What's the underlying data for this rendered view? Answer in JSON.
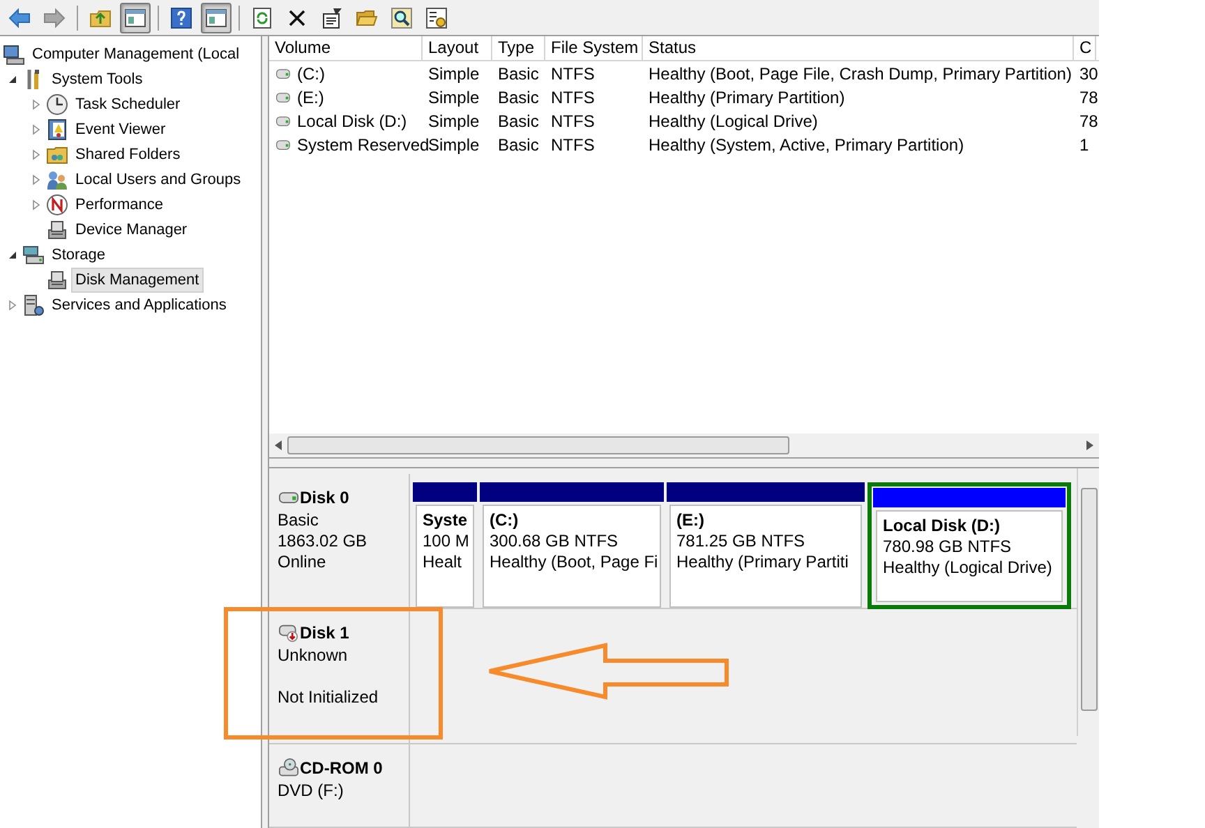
{
  "toolbar": [
    {
      "kind": "back",
      "pressed": false
    },
    {
      "kind": "forward",
      "pressed": false
    },
    {
      "kind": "separator"
    },
    {
      "kind": "folder-up",
      "pressed": false
    },
    {
      "kind": "panel",
      "pressed": true
    },
    {
      "kind": "separator"
    },
    {
      "kind": "help",
      "pressed": false
    },
    {
      "kind": "panel",
      "pressed": true
    },
    {
      "kind": "separator"
    },
    {
      "kind": "refresh",
      "pressed": false
    },
    {
      "kind": "delete",
      "pressed": false
    },
    {
      "kind": "properties",
      "pressed": false
    },
    {
      "kind": "open",
      "pressed": false
    },
    {
      "kind": "search",
      "pressed": false
    },
    {
      "kind": "settings",
      "pressed": false
    }
  ],
  "tree": [
    {
      "label": "Computer Management (Local",
      "kind": "computer",
      "selected": false,
      "children": [
        {
          "label": "System Tools",
          "kind": "tools",
          "expanded": true,
          "selected": false,
          "children": [
            {
              "label": "Task Scheduler",
              "kind": "clock",
              "expanded": false,
              "selected": false
            },
            {
              "label": "Event Viewer",
              "kind": "log",
              "expanded": false,
              "selected": false
            },
            {
              "label": "Shared Folders",
              "kind": "folder",
              "expanded": false,
              "selected": false
            },
            {
              "label": "Local Users and Groups",
              "kind": "users",
              "expanded": false,
              "selected": false
            },
            {
              "label": "Performance",
              "kind": "gauge",
              "expanded": false,
              "selected": false
            },
            {
              "label": "Device Manager",
              "kind": "device",
              "selected": false
            }
          ]
        },
        {
          "label": "Storage",
          "kind": "storage",
          "expanded": true,
          "selected": false,
          "children": [
            {
              "label": "Disk Management",
              "kind": "device",
              "selected": true
            }
          ]
        },
        {
          "label": "Services and Applications",
          "kind": "services",
          "expanded": false,
          "selected": false
        }
      ]
    }
  ],
  "table": {
    "columns": [
      "Volume",
      "Layout",
      "Type",
      "File System",
      "Status",
      "C"
    ],
    "rows": [
      [
        "(C:)",
        "Simple",
        "Basic",
        "NTFS",
        "Healthy (Boot, Page File, Crash Dump, Primary Partition)",
        "30"
      ],
      [
        "(E:)",
        "Simple",
        "Basic",
        "NTFS",
        "Healthy (Primary Partition)",
        "78"
      ],
      [
        "Local Disk (D:)",
        "Simple",
        "Basic",
        "NTFS",
        "Healthy (Logical Drive)",
        "78"
      ],
      [
        "System Reserved",
        "Simple",
        "Basic",
        "NTFS",
        "Healthy (System, Active, Primary Partition)",
        "1"
      ]
    ]
  },
  "disks": [
    {
      "kind": "disk",
      "name": "Disk 0",
      "lines": [
        "Basic",
        "1863.02 GB",
        "Online"
      ],
      "partitions": [
        {
          "name": "Syste",
          "size": "100 M",
          "status": "Healt",
          "selected": false
        },
        {
          "name": "(C:)",
          "size": "300.68 GB NTFS",
          "status": "Healthy (Boot, Page Fi",
          "selected": false
        },
        {
          "name": "(E:)",
          "size": "781.25 GB NTFS",
          "status": "Healthy (Primary Partiti",
          "selected": false
        },
        {
          "name": "Local Disk  (D:)",
          "size": "780.98 GB NTFS",
          "status": "Healthy (Logical Drive)",
          "selected": true
        }
      ]
    },
    {
      "kind": "uninitialized",
      "name": "Disk 1",
      "lines": [
        "Unknown",
        "Not Initialized"
      ]
    },
    {
      "kind": "cdrom",
      "name": "CD-ROM 0",
      "lines": [
        "DVD (F:)"
      ]
    }
  ]
}
